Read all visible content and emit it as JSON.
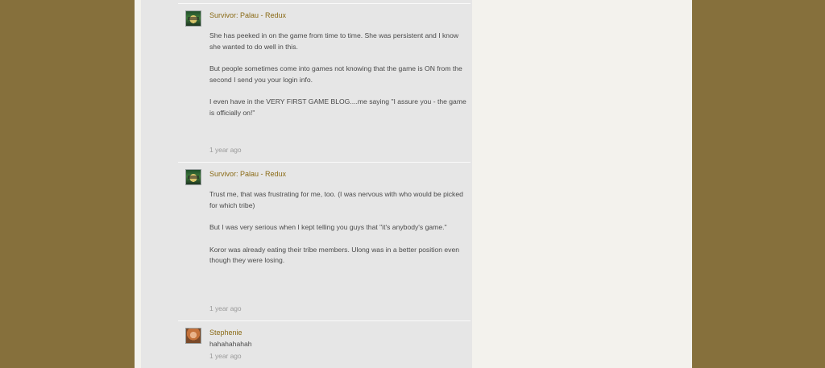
{
  "comments": [
    {
      "author": "Survivor: Palau - Redux",
      "paragraphs": [
        "She has peeked in on the game from time to time.  She was persistent and I know she wanted to do well in this.",
        "But people sometimes come into games not knowing that the game is ON from the second I send you your login info.",
        "I even have in the VERY FIRST GAME BLOG....me saying \"I assure you - the game is officially on!\""
      ],
      "time": "1 year ago"
    },
    {
      "author": "Survivor: Palau - Redux",
      "paragraphs": [
        "Trust me, that was frustrating for me, too.  (I was nervous with who would be picked for which tribe)",
        "But I was very serious when I kept telling you guys that \"it's anybody's game.\"",
        "Koror was already eating their tribe members.  Ulong was in a better position even though they were losing."
      ],
      "time": "1 year ago"
    },
    {
      "author": "Stephenie",
      "paragraphs": [
        "hahahahahah"
      ],
      "time": "1 year ago"
    }
  ]
}
